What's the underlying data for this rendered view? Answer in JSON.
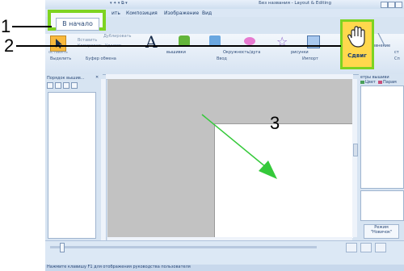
{
  "window": {
    "title": "Без названия - Layout & Editing",
    "quick_access_symbols": "▾  ✦ ▾  ⧉ ▾"
  },
  "menu": {
    "home_tab": "В начало",
    "tabs": [
      "ить",
      "Композиция",
      "Изображение",
      "Вид"
    ]
  },
  "ribbon": {
    "paste_label": "Вставить",
    "duplicate_label": "Дублировать",
    "copy_label": "Копировать",
    "delete_label": "Удалить",
    "small_text_a": "оставить",
    "small_text_b": "вышивки",
    "small_text_c": "Окружность/дуга",
    "small_text_d": "рисунки",
    "small_text_e": "ровнение",
    "small_text_f": "ст",
    "groups": {
      "select": "Выделить",
      "clipboard": "Буфер обмена",
      "input": "Ввод",
      "import": "Импорт",
      "right": "Сп"
    },
    "move_label": "Сдвиг"
  },
  "left_panel": {
    "title": "Порядок вышив...",
    "controls": "✕"
  },
  "right_panel": {
    "header": "етры вышиви",
    "color_label": "Цвет",
    "param_label": "Парам",
    "reset_button": "Режим \"Новичок\""
  },
  "status": {
    "text": "Нажмите клавишу F1 для отображения руководства пользователя"
  },
  "callouts": {
    "one": "1",
    "two": "2",
    "three": "3"
  }
}
